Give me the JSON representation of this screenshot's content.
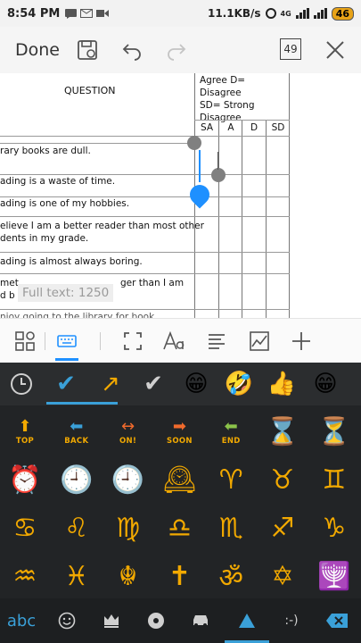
{
  "status": {
    "time": "8:54 PM",
    "speed": "11.1KB/s",
    "network": "4G",
    "battery": "46"
  },
  "toolbar": {
    "done_label": "Done",
    "page_count": "49"
  },
  "doc": {
    "question_header": "QUESTION",
    "scale_lines": [
      "Agree  D= Disagree",
      "SD=         Strong",
      "Disagree"
    ],
    "columns": [
      "SA",
      "A",
      "D",
      "SD"
    ],
    "rows": [
      [
        "rary books are dull."
      ],
      [
        "ading is a waste of time."
      ],
      [
        "ading is one of my hobbies."
      ],
      [
        "elieve I am a better reader than most other",
        "dents in my grade."
      ],
      [
        "ading is almost always boring."
      ],
      [
        "met",
        "d b"
      ],
      [
        "njoy going to the library for book"
      ]
    ],
    "tail_fragment": "ger than I am",
    "full_text_tip": "Full text: 1250"
  },
  "keyboard": {
    "recent": [
      "✔",
      "↗",
      "✔",
      "😁",
      "🤣",
      "👍",
      "😁"
    ],
    "grid": [
      [
        {
          "icon": "⬆",
          "label": "TOP",
          "color": "#f2a900"
        },
        {
          "icon": "⬅",
          "label": "BACK",
          "color": "#3aa0d8"
        },
        {
          "icon": "↔",
          "label": "ON!",
          "color": "#f06a2c"
        },
        {
          "icon": "➡",
          "label": "SOON",
          "color": "#f06a2c"
        },
        {
          "icon": "⬅",
          "label": "END",
          "color": "#8bc34a"
        },
        {
          "icon": "⌛",
          "label": "",
          "color": "#e57373"
        },
        {
          "icon": "⏳",
          "label": "",
          "color": "#e57373"
        }
      ],
      [
        {
          "icon": "⏰",
          "label": ""
        },
        {
          "icon": "🕘",
          "label": ""
        },
        {
          "icon": "🕘",
          "label": ""
        },
        {
          "icon": "🕰",
          "label": ""
        },
        {
          "icon": "♈",
          "label": ""
        },
        {
          "icon": "♉",
          "label": ""
        },
        {
          "icon": "♊",
          "label": ""
        }
      ],
      [
        {
          "icon": "♋",
          "label": ""
        },
        {
          "icon": "♌",
          "label": ""
        },
        {
          "icon": "♍",
          "label": ""
        },
        {
          "icon": "♎",
          "label": ""
        },
        {
          "icon": "♏",
          "label": ""
        },
        {
          "icon": "♐",
          "label": ""
        },
        {
          "icon": "♑",
          "label": ""
        }
      ],
      [
        {
          "icon": "♒",
          "label": ""
        },
        {
          "icon": "♓",
          "label": ""
        },
        {
          "icon": "☬",
          "label": ""
        },
        {
          "icon": "✝",
          "label": ""
        },
        {
          "icon": "ॐ",
          "label": ""
        },
        {
          "icon": "✡",
          "label": ""
        },
        {
          "icon": "🕎",
          "label": ""
        }
      ]
    ],
    "bottom": {
      "abc_label": "abc",
      "emoticon_label": ":-)"
    },
    "accent": "#3aa0d8"
  }
}
